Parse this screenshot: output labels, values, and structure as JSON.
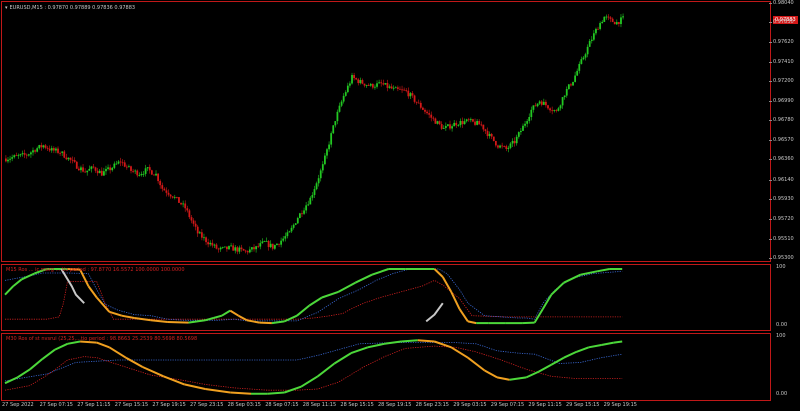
{
  "symbol_info": {
    "arrow": "▾",
    "text": "EURUSD,M15 : 0.97870 0.97889 0.97836 0.97883"
  },
  "current_price": "0.97883",
  "price_scale": [
    "0.98040",
    "0.97830",
    "0.97620",
    "0.97410",
    "0.97200",
    "0.96990",
    "0.96780",
    "0.96570",
    "0.96360",
    "0.96140",
    "0.95930",
    "0.95720",
    "0.95510",
    "0.95300"
  ],
  "indicator1": {
    "label": "M15 Ros ... ic marg ... tio period : 97.8770 16.5572 100.0000 100.0000",
    "top": "100",
    "bottom": "0.00"
  },
  "indicator2": {
    "label": "M30 Ros of st nvsrui (25,25,...tio period : 98.8663 25.2539 80.5698 80.5698",
    "top": "100",
    "bottom": "0.00"
  },
  "time_axis": [
    "27 Sep 2022",
    "27 Sep 07:15",
    "27 Sep 11:15",
    "27 Sep 15:15",
    "27 Sep 19:15",
    "27 Sep 23:15",
    "28 Sep 03:15",
    "28 Sep 07:15",
    "28 Sep 11:15",
    "28 Sep 15:15",
    "28 Sep 19:15",
    "28 Sep 23:15",
    "29 Sep 03:15",
    "29 Sep 07:15",
    "29 Sep 11:15",
    "29 Sep 15:15",
    "29 Sep 19:15"
  ],
  "colors": {
    "bull": "#22c822",
    "bear": "#d41818",
    "frame": "#c01818",
    "osc_up": "#4cd83a",
    "osc_down": "#f0a020",
    "osc_neutral": "#c8c8c8",
    "signal_blue": "#3a6ad8",
    "signal_red": "#d42020"
  },
  "chart_data": [
    {
      "type": "candlestick",
      "title": "EURUSD,M15",
      "ylim": [
        0.9528,
        0.9806
      ],
      "close_path": [
        [
          0,
          0.9638
        ],
        [
          5,
          0.964
        ],
        [
          10,
          0.9642
        ],
        [
          14,
          0.9648
        ],
        [
          18,
          0.9652
        ],
        [
          22,
          0.9647
        ],
        [
          26,
          0.9645
        ],
        [
          30,
          0.9638
        ],
        [
          34,
          0.963
        ],
        [
          38,
          0.9624
        ],
        [
          42,
          0.9628
        ],
        [
          46,
          0.9622
        ],
        [
          50,
          0.9627
        ],
        [
          55,
          0.9635
        ],
        [
          60,
          0.9625
        ],
        [
          64,
          0.9622
        ],
        [
          68,
          0.9626
        ],
        [
          72,
          0.9621
        ],
        [
          75,
          0.9606
        ],
        [
          80,
          0.9598
        ],
        [
          86,
          0.9585
        ],
        [
          92,
          0.9558
        ],
        [
          96,
          0.955
        ],
        [
          102,
          0.954
        ],
        [
          108,
          0.9542
        ],
        [
          115,
          0.9538
        ],
        [
          120,
          0.9542
        ],
        [
          124,
          0.9548
        ],
        [
          128,
          0.9543
        ],
        [
          132,
          0.955
        ],
        [
          136,
          0.9558
        ],
        [
          140,
          0.9575
        ],
        [
          146,
          0.9595
        ],
        [
          152,
          0.963
        ],
        [
          158,
          0.968
        ],
        [
          162,
          0.9705
        ],
        [
          166,
          0.9725
        ],
        [
          170,
          0.972
        ],
        [
          175,
          0.9716
        ],
        [
          180,
          0.9718
        ],
        [
          186,
          0.9712
        ],
        [
          192,
          0.971
        ],
        [
          198,
          0.9696
        ],
        [
          204,
          0.9682
        ],
        [
          210,
          0.967
        ],
        [
          216,
          0.9676
        ],
        [
          222,
          0.9678
        ],
        [
          228,
          0.9674
        ],
        [
          232,
          0.9662
        ],
        [
          236,
          0.9652
        ],
        [
          240,
          0.9648
        ],
        [
          244,
          0.9656
        ],
        [
          248,
          0.9672
        ],
        [
          252,
          0.969
        ],
        [
          256,
          0.97
        ],
        [
          260,
          0.9694
        ],
        [
          264,
          0.9688
        ],
        [
          268,
          0.9708
        ],
        [
          272,
          0.9722
        ],
        [
          276,
          0.9742
        ],
        [
          280,
          0.9762
        ],
        [
          284,
          0.978
        ],
        [
          287,
          0.979
        ],
        [
          290,
          0.9786
        ],
        [
          293,
          0.9784
        ],
        [
          296,
          0.9788
        ]
      ],
      "last_bar": 296
    },
    {
      "type": "line",
      "title": "M15 oscillator",
      "ylim": [
        0,
        100
      ],
      "osc_path": [
        [
          0,
          55
        ],
        [
          4,
          70
        ],
        [
          8,
          82
        ],
        [
          14,
          92
        ],
        [
          20,
          100
        ],
        [
          30,
          100
        ],
        [
          36,
          99
        ],
        [
          40,
          70
        ],
        [
          44,
          50
        ],
        [
          50,
          25
        ],
        [
          56,
          18
        ],
        [
          62,
          14
        ],
        [
          70,
          10
        ],
        [
          78,
          7
        ],
        [
          88,
          6
        ],
        [
          96,
          10
        ],
        [
          100,
          14
        ],
        [
          104,
          18
        ],
        [
          108,
          27
        ],
        [
          112,
          18
        ],
        [
          116,
          10
        ],
        [
          122,
          6
        ],
        [
          128,
          5
        ],
        [
          134,
          8
        ],
        [
          140,
          18
        ],
        [
          146,
          36
        ],
        [
          152,
          50
        ],
        [
          160,
          60
        ],
        [
          168,
          76
        ],
        [
          176,
          90
        ],
        [
          184,
          100
        ],
        [
          192,
          100
        ],
        [
          200,
          100
        ],
        [
          206,
          100
        ],
        [
          210,
          86
        ],
        [
          214,
          60
        ],
        [
          218,
          30
        ],
        [
          222,
          8
        ],
        [
          226,
          5
        ],
        [
          232,
          5
        ],
        [
          240,
          5
        ],
        [
          248,
          5
        ],
        [
          254,
          6
        ],
        [
          258,
          30
        ],
        [
          262,
          55
        ],
        [
          268,
          76
        ],
        [
          276,
          90
        ],
        [
          284,
          96
        ],
        [
          290,
          100
        ],
        [
          296,
          100
        ]
      ],
      "blue_path": [
        [
          0,
          80
        ],
        [
          12,
          88
        ],
        [
          18,
          93
        ],
        [
          30,
          93
        ],
        [
          40,
          92
        ],
        [
          44,
          64
        ],
        [
          48,
          38
        ],
        [
          54,
          28
        ],
        [
          62,
          20
        ],
        [
          70,
          18
        ],
        [
          78,
          12
        ],
        [
          86,
          10
        ],
        [
          94,
          10
        ],
        [
          102,
          10
        ],
        [
          110,
          12
        ],
        [
          116,
          9
        ],
        [
          126,
          9
        ],
        [
          134,
          9
        ],
        [
          140,
          9
        ],
        [
          150,
          24
        ],
        [
          160,
          48
        ],
        [
          170,
          64
        ],
        [
          178,
          80
        ],
        [
          186,
          92
        ],
        [
          194,
          100
        ],
        [
          208,
          100
        ],
        [
          212,
          92
        ],
        [
          218,
          64
        ],
        [
          222,
          40
        ],
        [
          230,
          18
        ],
        [
          246,
          14
        ],
        [
          250,
          14
        ],
        [
          254,
          12
        ],
        [
          258,
          40
        ],
        [
          264,
          64
        ],
        [
          272,
          84
        ],
        [
          282,
          92
        ],
        [
          296,
          96
        ]
      ],
      "red_path": [
        [
          0,
          12
        ],
        [
          14,
          12
        ],
        [
          20,
          12
        ],
        [
          26,
          16
        ],
        [
          28,
          40
        ],
        [
          30,
          78
        ],
        [
          44,
          78
        ],
        [
          48,
          40
        ],
        [
          52,
          12
        ],
        [
          100,
          12
        ],
        [
          110,
          12
        ],
        [
          140,
          12
        ],
        [
          148,
          14
        ],
        [
          152,
          16
        ],
        [
          156,
          18
        ],
        [
          162,
          22
        ],
        [
          166,
          30
        ],
        [
          172,
          40
        ],
        [
          180,
          50
        ],
        [
          190,
          60
        ],
        [
          200,
          70
        ],
        [
          206,
          80
        ],
        [
          210,
          72
        ],
        [
          218,
          48
        ],
        [
          224,
          18
        ],
        [
          240,
          16
        ],
        [
          260,
          16
        ],
        [
          270,
          16
        ],
        [
          296,
          16
        ]
      ],
      "gray_path": [
        [
          27,
          100
        ],
        [
          32,
          70
        ],
        [
          34,
          55
        ],
        [
          38,
          40
        ]
      ],
      "gray_path2": [
        [
          202,
          8
        ],
        [
          206,
          20
        ],
        [
          210,
          40
        ]
      ]
    },
    {
      "type": "line",
      "title": "M30 oscillator",
      "ylim": [
        0,
        100
      ],
      "osc_path": [
        [
          0,
          22
        ],
        [
          6,
          32
        ],
        [
          12,
          46
        ],
        [
          18,
          64
        ],
        [
          24,
          80
        ],
        [
          30,
          90
        ],
        [
          36,
          94
        ],
        [
          44,
          92
        ],
        [
          50,
          84
        ],
        [
          58,
          66
        ],
        [
          66,
          50
        ],
        [
          76,
          34
        ],
        [
          86,
          20
        ],
        [
          96,
          12
        ],
        [
          108,
          6
        ],
        [
          118,
          4
        ],
        [
          126,
          4
        ],
        [
          134,
          6
        ],
        [
          142,
          16
        ],
        [
          150,
          34
        ],
        [
          158,
          56
        ],
        [
          166,
          74
        ],
        [
          174,
          84
        ],
        [
          182,
          90
        ],
        [
          190,
          94
        ],
        [
          198,
          96
        ],
        [
          206,
          94
        ],
        [
          214,
          84
        ],
        [
          222,
          66
        ],
        [
          230,
          44
        ],
        [
          236,
          32
        ],
        [
          242,
          28
        ],
        [
          250,
          32
        ],
        [
          256,
          42
        ],
        [
          262,
          54
        ],
        [
          268,
          66
        ],
        [
          274,
          76
        ],
        [
          280,
          84
        ],
        [
          286,
          88
        ],
        [
          292,
          92
        ],
        [
          296,
          94
        ]
      ],
      "blue_path": [
        [
          0,
          26
        ],
        [
          10,
          32
        ],
        [
          20,
          38
        ],
        [
          34,
          58
        ],
        [
          44,
          60
        ],
        [
          54,
          62
        ],
        [
          66,
          62
        ],
        [
          80,
          62
        ],
        [
          100,
          62
        ],
        [
          120,
          62
        ],
        [
          134,
          62
        ],
        [
          140,
          62
        ],
        [
          150,
          70
        ],
        [
          160,
          80
        ],
        [
          170,
          90
        ],
        [
          186,
          92
        ],
        [
          206,
          92
        ],
        [
          216,
          92
        ],
        [
          226,
          90
        ],
        [
          236,
          78
        ],
        [
          246,
          74
        ],
        [
          254,
          72
        ],
        [
          266,
          56
        ],
        [
          276,
          58
        ],
        [
          286,
          66
        ],
        [
          296,
          72
        ]
      ],
      "red_path": [
        [
          0,
          10
        ],
        [
          12,
          18
        ],
        [
          22,
          40
        ],
        [
          30,
          62
        ],
        [
          38,
          68
        ],
        [
          44,
          66
        ],
        [
          56,
          52
        ],
        [
          70,
          36
        ],
        [
          84,
          28
        ],
        [
          96,
          20
        ],
        [
          110,
          14
        ],
        [
          126,
          10
        ],
        [
          140,
          10
        ],
        [
          150,
          12
        ],
        [
          160,
          24
        ],
        [
          172,
          50
        ],
        [
          182,
          68
        ],
        [
          192,
          82
        ],
        [
          206,
          86
        ],
        [
          216,
          84
        ],
        [
          226,
          76
        ],
        [
          238,
          62
        ],
        [
          250,
          46
        ],
        [
          262,
          34
        ],
        [
          274,
          30
        ],
        [
          286,
          30
        ],
        [
          296,
          30
        ]
      ]
    }
  ]
}
